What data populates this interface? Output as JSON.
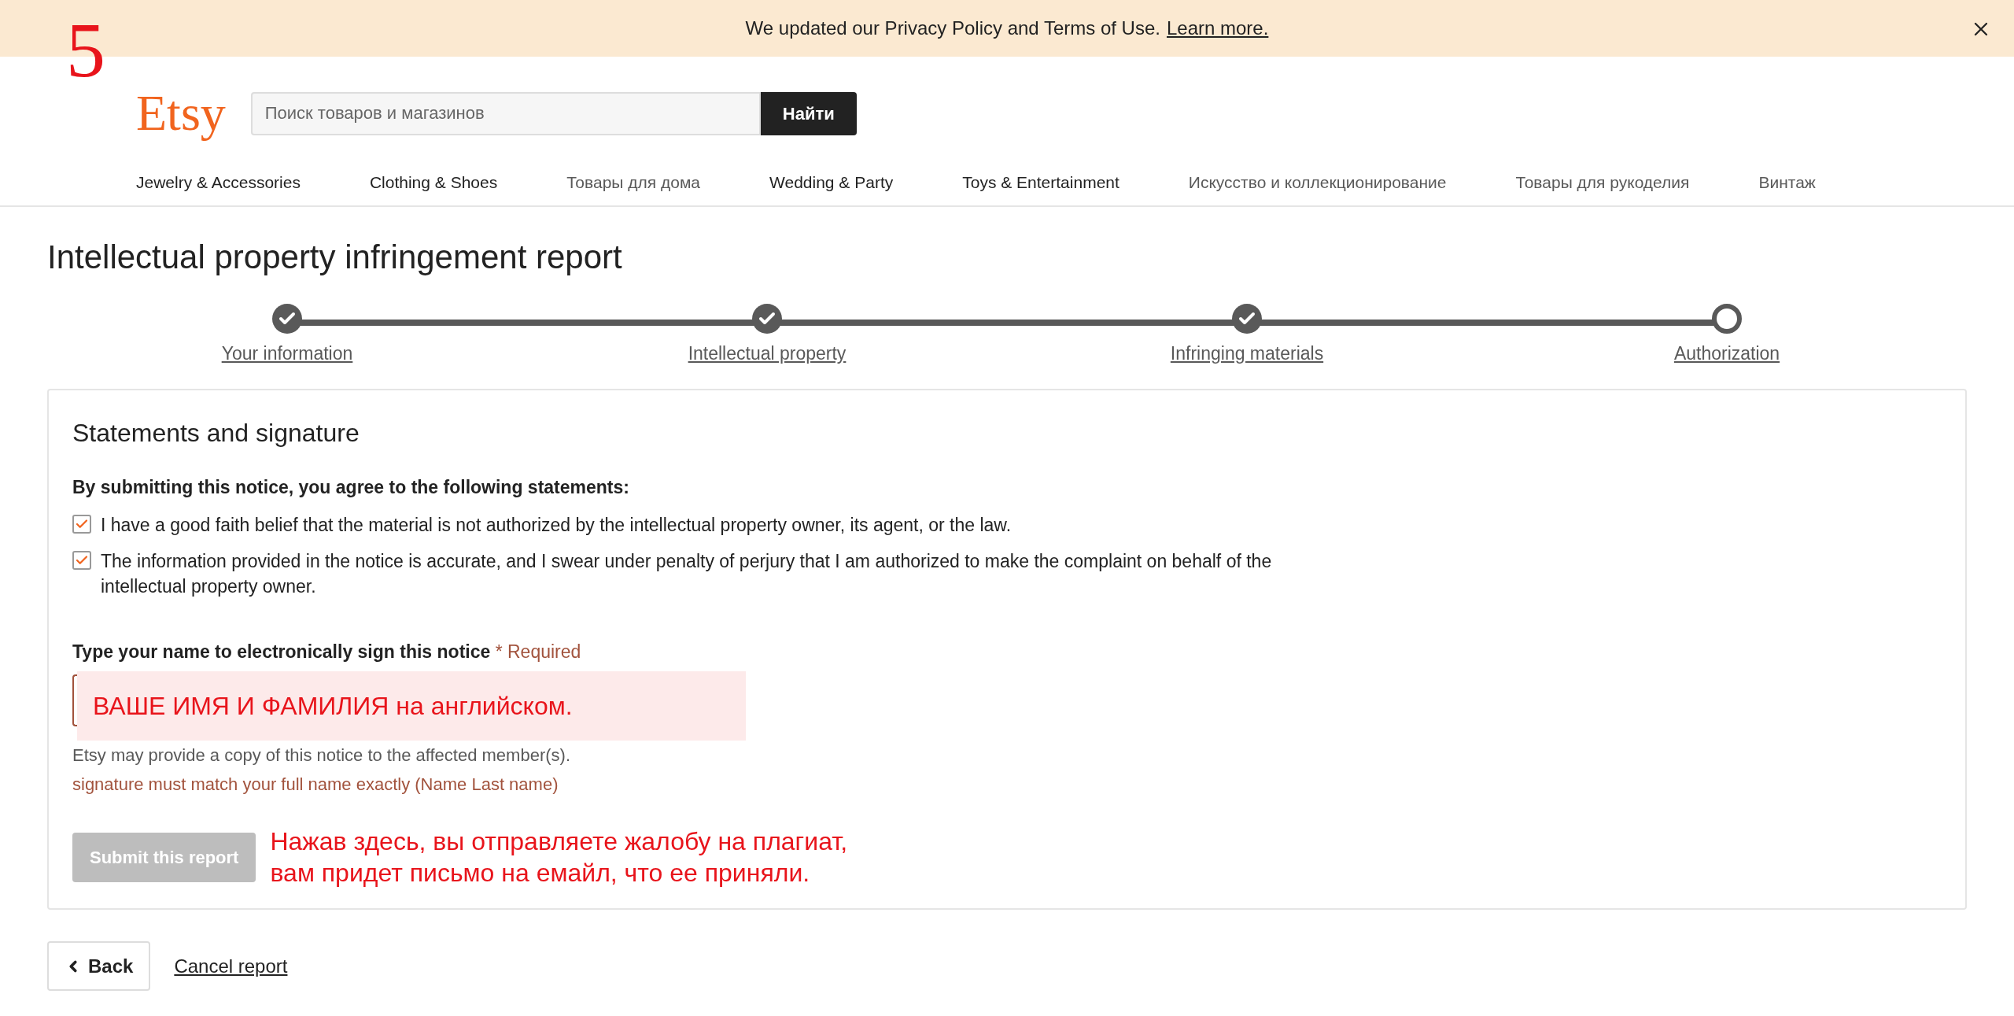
{
  "banner": {
    "text": "We updated our Privacy Policy and Terms of Use.",
    "link": "Learn more."
  },
  "annotation_number": "5",
  "header": {
    "logo": "Etsy",
    "search": {
      "placeholder": "Поиск товаров и магазинов"
    },
    "search_button": "Найти"
  },
  "nav": [
    {
      "label": "Jewelry & Accessories",
      "bold": true
    },
    {
      "label": "Clothing & Shoes",
      "bold": true
    },
    {
      "label": "Товары для дома",
      "bold": false
    },
    {
      "label": "Wedding & Party",
      "bold": true
    },
    {
      "label": "Toys & Entertainment",
      "bold": true
    },
    {
      "label": "Искусство и коллекционирование",
      "bold": false
    },
    {
      "label": "Товары для рукоделия",
      "bold": false
    },
    {
      "label": "Винтаж",
      "bold": false
    }
  ],
  "title": "Intellectual property infringement report",
  "steps": [
    {
      "label": "Your information",
      "completed": true
    },
    {
      "label": "Intellectual property",
      "completed": true
    },
    {
      "label": "Infringing materials",
      "completed": true
    },
    {
      "label": "Authorization",
      "completed": false
    }
  ],
  "card": {
    "title": "Statements and signature",
    "intro": "By submitting this notice, you agree to the following statements:",
    "statements": [
      {
        "text": "I have a good faith belief that the material is not authorized by the intellectual property owner, its agent, or the law.",
        "checked": true
      },
      {
        "text": "The information provided in the notice is accurate, and I swear under penalty of perjury that I am authorized to make the complaint on behalf of the intellectual property owner.",
        "checked": true
      }
    ],
    "signature_label": "Type your name to electronically sign this notice",
    "required": "* Required",
    "signature_note": "ВАШЕ ИМЯ И ФАМИЛИЯ на английском.",
    "help": "Etsy may provide a copy of this notice to the affected member(s).",
    "error": "signature must match your full name exactly (Name Last name)",
    "submit": {
      "label": "Submit this report",
      "disabled": true
    },
    "submit_note": [
      "Нажав здесь, вы отправляете жалобу на плагиат,",
      "вам придет письмо на емайл, что ее приняли."
    ]
  },
  "footer": {
    "back": "Back",
    "cancel": "Cancel report"
  }
}
